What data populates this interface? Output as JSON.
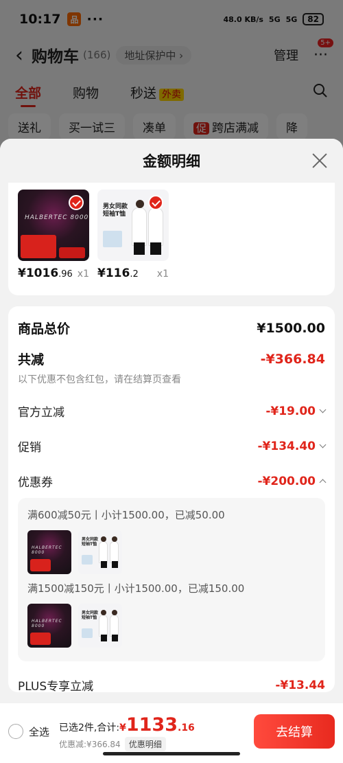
{
  "status_bar": {
    "time": "10:17",
    "app_badge": "品",
    "dots": "···",
    "speed": "48.0 KB/s",
    "signal1": "5G",
    "signal2": "5G",
    "battery": "82"
  },
  "nav": {
    "back_icon": "‹",
    "title": "购物车",
    "count": "(166)",
    "address": "地址保护中 ›",
    "manage": "管理",
    "more_icon": "···",
    "badge": "5+"
  },
  "tabs": {
    "all": "全部",
    "shopping": "购物",
    "miaosong": "秒送",
    "waimai_tag": "外卖"
  },
  "chips": [
    "送礼",
    "买一试三",
    "凑单",
    "跨店满减",
    "降"
  ],
  "chip_promo_mark": "促",
  "sheet": {
    "title": "金额明细",
    "products": [
      {
        "price_int": "¥1016",
        "price_dec": ".96",
        "qty": "x1",
        "image": "racket"
      },
      {
        "price_int": "¥116",
        "price_dec": ".2",
        "qty": "x1",
        "image": "tshirt"
      }
    ],
    "goods_total_label": "商品总价",
    "goods_total_value": "¥1500.00",
    "total_discount_label": "共减",
    "total_discount_value": "-¥366.84",
    "discount_note": "以下优惠不包含红包，请在结算页查看",
    "official_label": "官方立减",
    "official_value": "-¥19.00",
    "promo_label": "促销",
    "promo_value": "-¥134.40",
    "coupon_label": "优惠券",
    "coupon_value": "-¥200.00",
    "coupons": [
      {
        "text": "满600减50元丨小计1500.00，已减50.00"
      },
      {
        "text": "满1500减150元丨小计1500.00，已减150.00"
      }
    ],
    "plus_label": "PLUS专享立减",
    "plus_value": "-¥13.44"
  },
  "bottom": {
    "select_all": "全选",
    "selected_text": "已选2件,合计:",
    "total_currency": "¥",
    "total_int": "1133",
    "total_dec": ".16",
    "discount_text": "优惠减:¥366.84",
    "detail_button": "优惠明细",
    "checkout": "去结算"
  },
  "colors": {
    "accent": "#e0251b",
    "checkout": "#ff4a3d"
  }
}
